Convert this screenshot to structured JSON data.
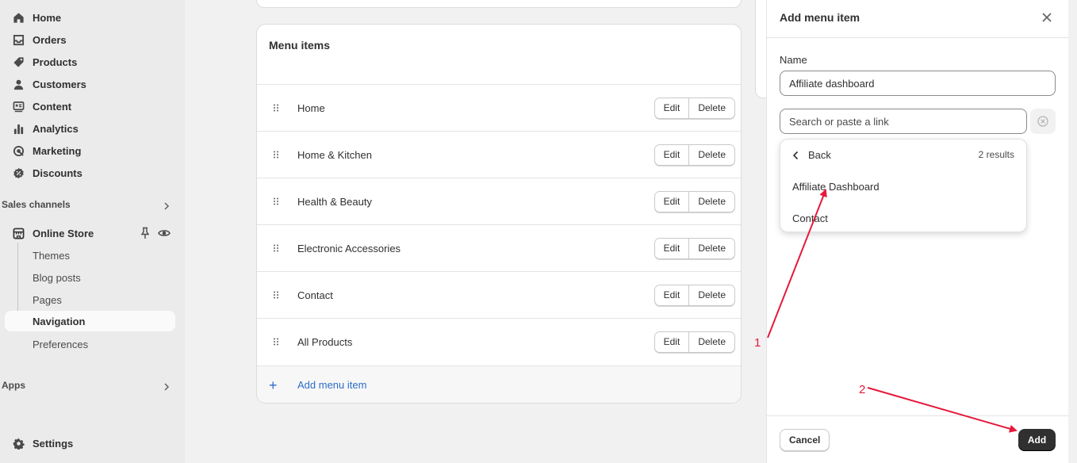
{
  "sidebar": {
    "items": [
      {
        "label": "Home",
        "icon": "home-icon"
      },
      {
        "label": "Orders",
        "icon": "inbox-icon"
      },
      {
        "label": "Products",
        "icon": "tag-icon"
      },
      {
        "label": "Customers",
        "icon": "person-icon"
      },
      {
        "label": "Content",
        "icon": "content-icon"
      },
      {
        "label": "Analytics",
        "icon": "bar-chart-icon"
      },
      {
        "label": "Marketing",
        "icon": "target-icon"
      },
      {
        "label": "Discounts",
        "icon": "discount-icon"
      }
    ],
    "sales_channels_label": "Sales channels",
    "online_store": {
      "label": "Online Store",
      "sub_items": [
        {
          "label": "Themes"
        },
        {
          "label": "Blog posts"
        },
        {
          "label": "Pages"
        },
        {
          "label": "Navigation",
          "active": true
        },
        {
          "label": "Preferences"
        }
      ]
    },
    "apps_label": "Apps",
    "settings_label": "Settings"
  },
  "menu_card": {
    "title": "Menu items",
    "items": [
      {
        "label": "Home"
      },
      {
        "label": "Home & Kitchen"
      },
      {
        "label": "Health & Beauty"
      },
      {
        "label": "Electronic Accessories"
      },
      {
        "label": "Contact"
      },
      {
        "label": "All Products"
      }
    ],
    "edit_label": "Edit",
    "delete_label": "Delete",
    "add_label": "Add menu item"
  },
  "panel": {
    "title": "Add menu item",
    "name_label": "Name",
    "name_value": "Affiliate dashboard",
    "link_placeholder": "Search or paste a link",
    "dropdown": {
      "back_label": "Back",
      "results_count": "2 results",
      "options": [
        "Affiliate Dashboard",
        "Contact"
      ]
    },
    "cancel_label": "Cancel",
    "add_label": "Add"
  },
  "annotations": {
    "color": "#e5193c",
    "labels": [
      "1",
      "2"
    ]
  }
}
